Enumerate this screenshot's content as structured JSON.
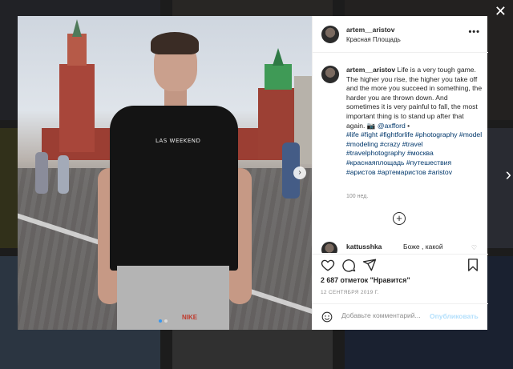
{
  "post": {
    "username": "artem__aristov",
    "location": "Красная Площадь",
    "more": "•••",
    "caption_text": " Life is a very tough game. The higher you rise, the higher you take off and the more you succeed in something, the harder you are thrown down. And sometimes it is very painful to fall, the most important thing is to stand up after that again. 📷 ",
    "photographer": "@axfford",
    "bullet": " •",
    "hashtags": "#life #fight #fightforlife #photography #model #modeling #crazy #travel #travelphotography #москва #краснаяплощадь #путешествия #аристов #артемаристов #aristov",
    "age": "100 нед.",
    "shirt_text": "LAS WEEKEND",
    "shorts_logo": "NIKE",
    "photo_next": "›"
  },
  "comment": {
    "username": "kattusshka",
    "text": "Боже , какой"
  },
  "likes": "2 687 отметок \"Нравится\"",
  "date": "12 СЕНТЯБРЯ 2019 Г.",
  "add_comment": {
    "placeholder": "Добавьте комментарий...",
    "publish_label": "Опубликовать"
  },
  "modal": {
    "close": "✕",
    "next": "›"
  },
  "icons": {
    "like": "heart-icon",
    "comment": "comment-icon",
    "share": "share-icon",
    "save": "bookmark-icon",
    "emoji": "emoji-icon",
    "plus": "plus-circle-icon"
  },
  "colors": {
    "link": "#00376b",
    "publish_disabled": "#b2dffc",
    "dot_active": "#3897f0"
  }
}
